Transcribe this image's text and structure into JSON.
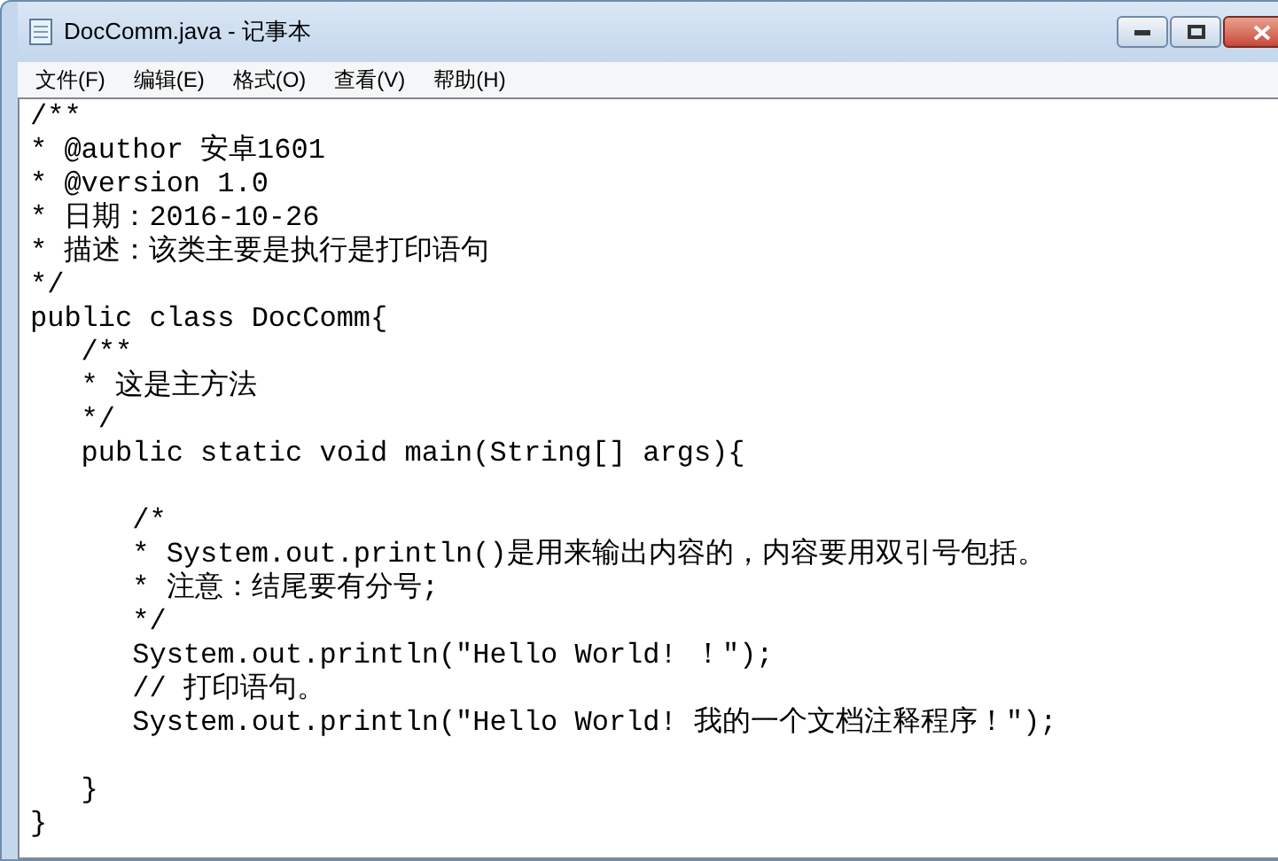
{
  "window": {
    "title": "DocComm.java - 记事本"
  },
  "menu": [
    "文件(F)",
    "编辑(E)",
    "格式(O)",
    "查看(V)",
    "帮助(H)"
  ],
  "lines": [
    {
      "kind": "text",
      "text": "/**"
    },
    {
      "kind": "text",
      "text": "* @author 安卓1601"
    },
    {
      "kind": "text",
      "text": "* @version 1.0"
    },
    {
      "kind": "text",
      "text": "* 日期：2016-10-26"
    },
    {
      "kind": "text",
      "text": "* 描述：该类主要是执行是打印语句"
    },
    {
      "kind": "text",
      "text": "*/"
    },
    {
      "kind": "text",
      "text": "public class DocComm{"
    },
    {
      "kind": "text",
      "text": "   /**"
    },
    {
      "kind": "text",
      "text": "   * 这是主方法"
    },
    {
      "kind": "text",
      "text": "   */"
    },
    {
      "kind": "text",
      "text": "   public static void main(String[] args){"
    },
    {
      "kind": "blank"
    },
    {
      "kind": "text",
      "text": "      /*"
    },
    {
      "kind": "text",
      "text": "      * System.out.println()是用来输出内容的，内容要用双引号包括。"
    },
    {
      "kind": "text",
      "text": "      * 注意：结尾要有分号;"
    },
    {
      "kind": "text",
      "text": "      */"
    },
    {
      "kind": "text",
      "text": "      System.out.println(\"Hello World! ！\");"
    },
    {
      "kind": "text",
      "text": "      // 打印语句。"
    },
    {
      "kind": "text",
      "text": "      System.out.println(\"Hello World! 我的一个文档注释程序！\");"
    },
    {
      "kind": "blank"
    },
    {
      "kind": "text",
      "text": "   }"
    },
    {
      "kind": "text",
      "text": "}"
    }
  ]
}
